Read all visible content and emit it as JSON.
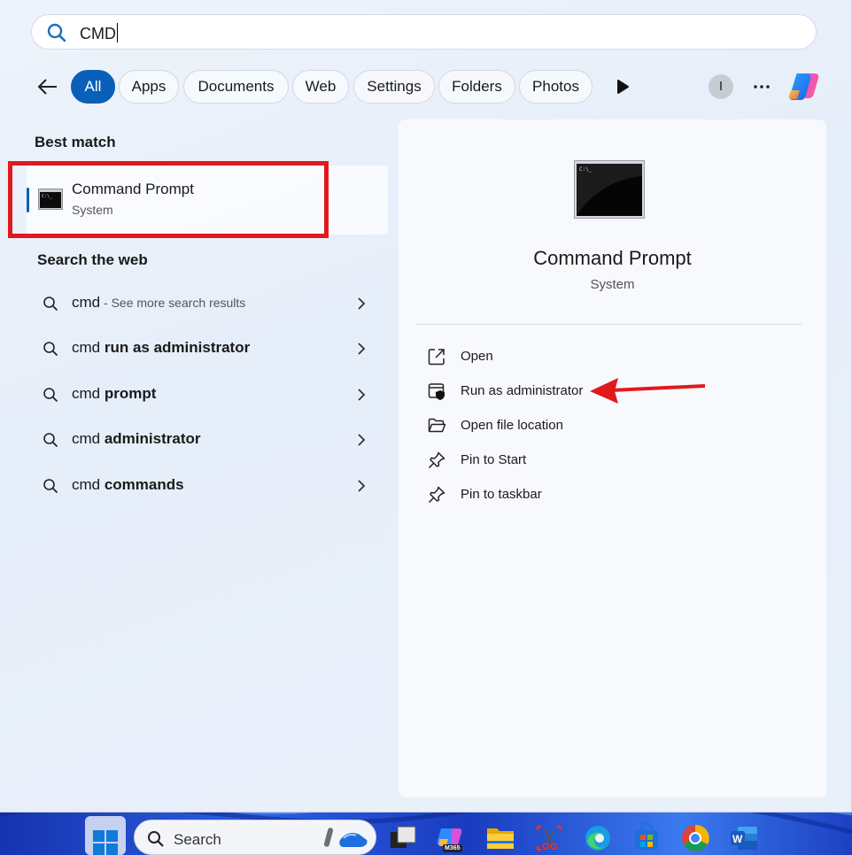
{
  "search": {
    "query": "CMD"
  },
  "filters": {
    "items": [
      {
        "label": "All",
        "active": true
      },
      {
        "label": "Apps"
      },
      {
        "label": "Documents"
      },
      {
        "label": "Web"
      },
      {
        "label": "Settings"
      },
      {
        "label": "Folders"
      },
      {
        "label": "Photos"
      }
    ],
    "avatar_initial": "I"
  },
  "best_match": {
    "heading": "Best match",
    "title": "Command Prompt",
    "subtitle": "System"
  },
  "web": {
    "heading": "Search the web",
    "results": [
      {
        "prefix": "cmd",
        "bold": "",
        "suffix": " - See more search results"
      },
      {
        "prefix": "cmd ",
        "bold": "run as administrator",
        "suffix": ""
      },
      {
        "prefix": "cmd ",
        "bold": "prompt",
        "suffix": ""
      },
      {
        "prefix": "cmd ",
        "bold": "administrator",
        "suffix": ""
      },
      {
        "prefix": "cmd ",
        "bold": "commands",
        "suffix": ""
      }
    ]
  },
  "preview": {
    "title": "Command Prompt",
    "subtitle": "System",
    "actions": [
      {
        "label": "Open",
        "icon": "open-external-icon"
      },
      {
        "label": "Run as administrator",
        "icon": "shield-window-icon"
      },
      {
        "label": "Open file location",
        "icon": "folder-open-icon"
      },
      {
        "label": "Pin to Start",
        "icon": "pin-icon"
      },
      {
        "label": "Pin to taskbar",
        "icon": "pin-icon"
      }
    ]
  },
  "taskbar": {
    "search_label": "Search",
    "m365_badge": "M365",
    "icons": [
      "windows-start-icon",
      "search-icon",
      "task-view-icon",
      "m365-copilot-icon",
      "file-explorer-icon",
      "snipping-tool-icon",
      "edge-icon",
      "store-icon",
      "chrome-icon",
      "word-icon"
    ]
  },
  "colors": {
    "accent": "#0a5fb8",
    "highlight_red": "#e0191d"
  }
}
